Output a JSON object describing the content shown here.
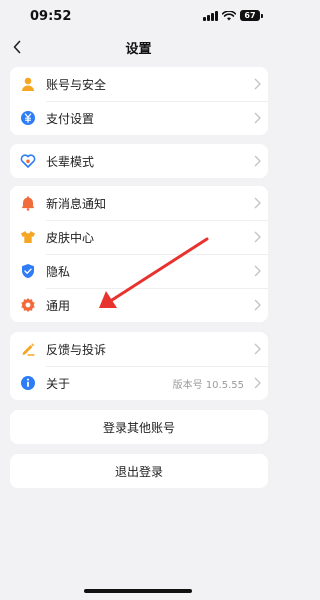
{
  "status_bar": {
    "time": "09:52",
    "battery": "67"
  },
  "nav": {
    "title": "设置"
  },
  "groups": [
    {
      "items": [
        {
          "label": "账号与安全",
          "icon": "person-icon",
          "color": "#f5a623"
        },
        {
          "label": "支付设置",
          "icon": "yuan-icon",
          "color": "#2e7cf6"
        }
      ]
    },
    {
      "items": [
        {
          "label": "长辈模式",
          "icon": "heart-icon",
          "color": "#2e7cf6"
        }
      ]
    },
    {
      "items": [
        {
          "label": "新消息通知",
          "icon": "bell-icon",
          "color": "#f26b3a"
        },
        {
          "label": "皮肤中心",
          "icon": "shirt-icon",
          "color": "#f5a623"
        },
        {
          "label": "隐私",
          "icon": "shield-icon",
          "color": "#2e7cf6"
        },
        {
          "label": "通用",
          "icon": "gear-icon",
          "color": "#f26b3a"
        }
      ]
    },
    {
      "items": [
        {
          "label": "反馈与投诉",
          "icon": "pencil-icon",
          "color": "#f5a623"
        },
        {
          "label": "关于",
          "icon": "info-icon",
          "color": "#2e7cf6",
          "value": "版本号 10.5.55"
        }
      ]
    }
  ],
  "actions": {
    "login_other": "登录其他账号",
    "logout": "退出登录"
  },
  "annotation": {
    "arrow_color": "#e8322e"
  }
}
